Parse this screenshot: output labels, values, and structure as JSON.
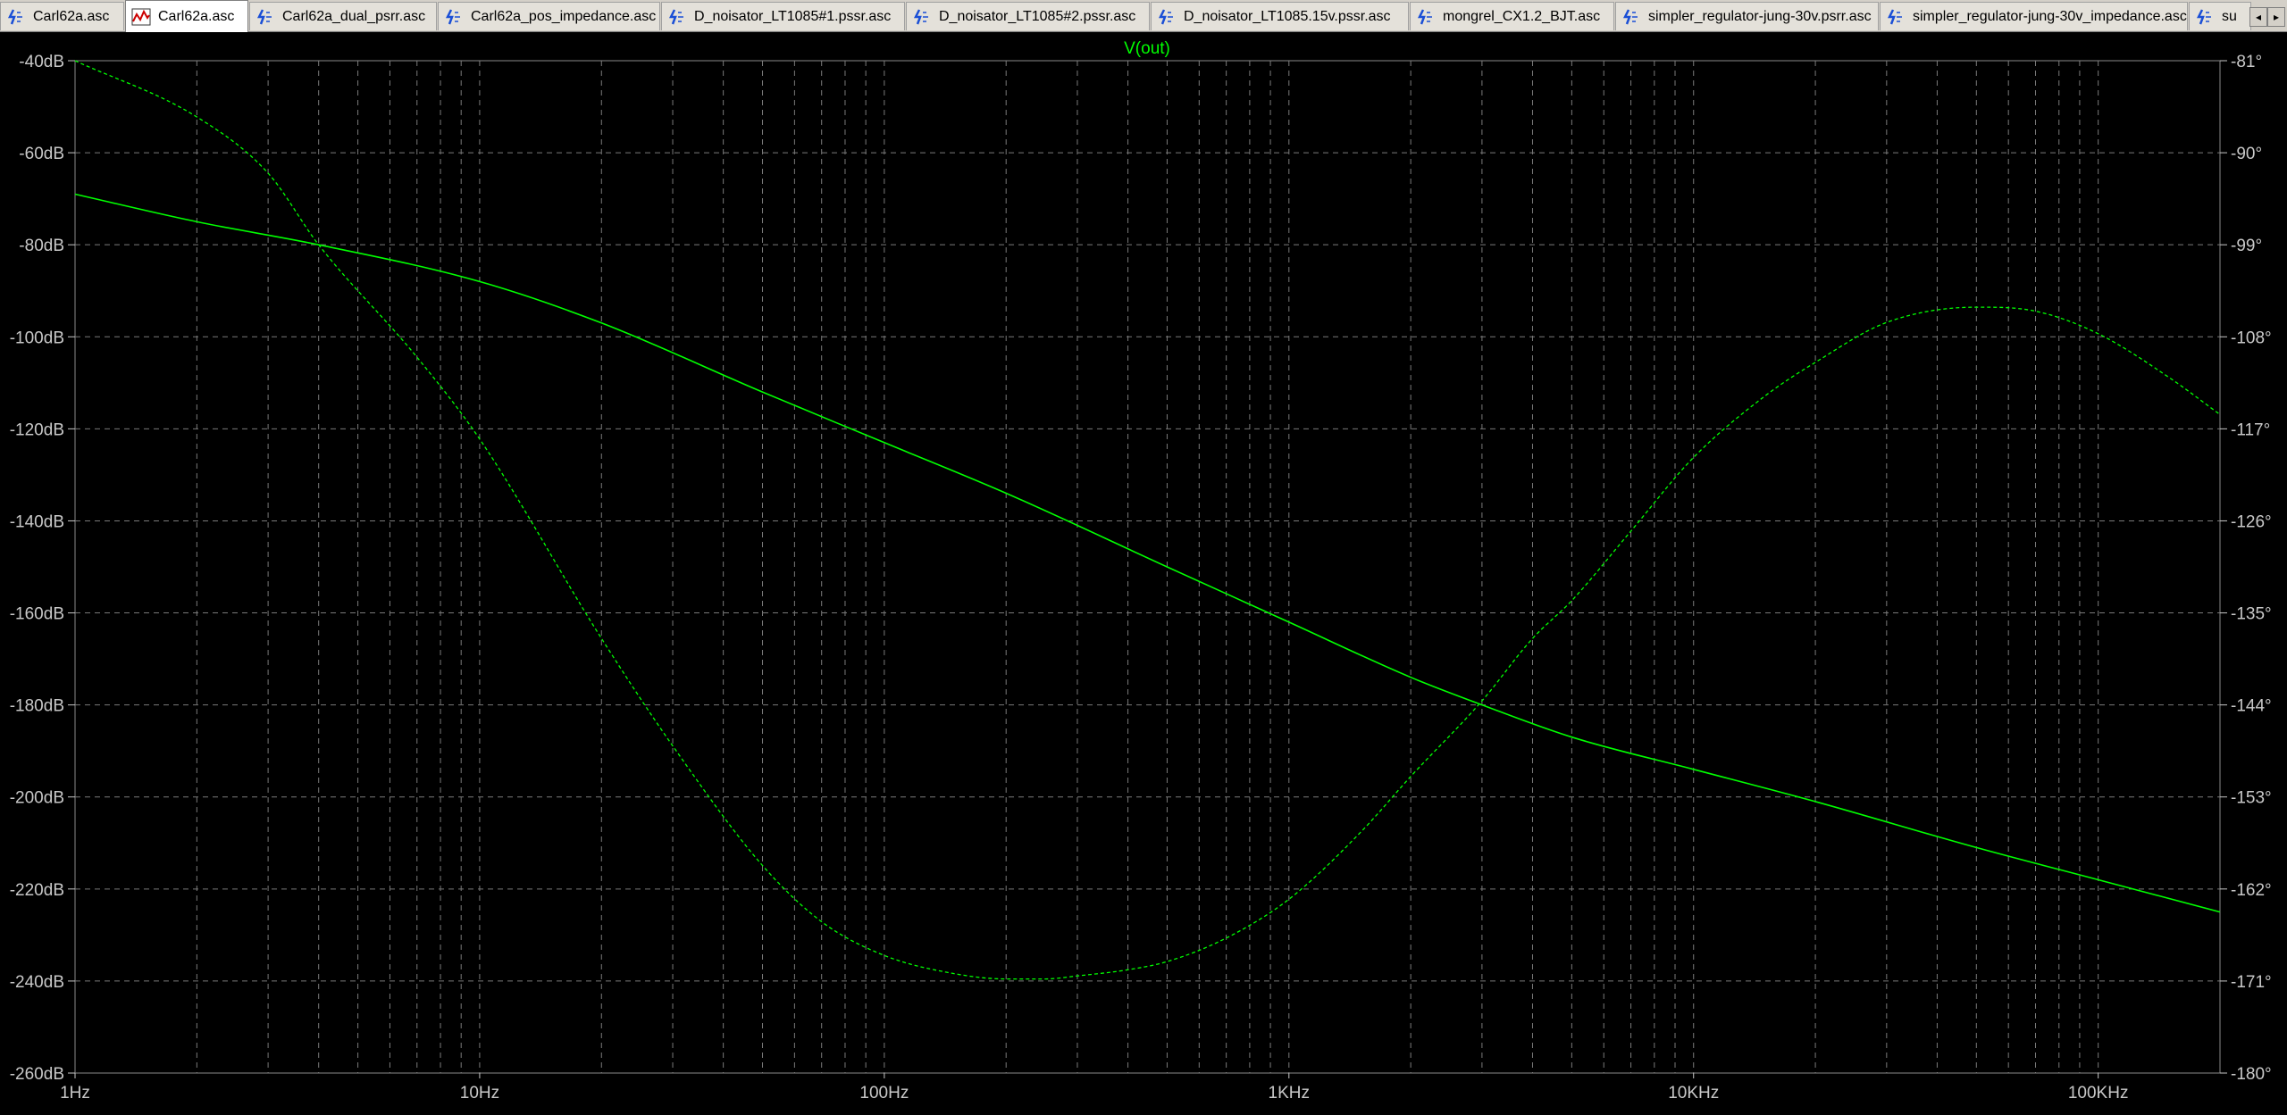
{
  "tabs": [
    {
      "label": "Carl62a.asc",
      "icon": "schematic-icon",
      "active": false
    },
    {
      "label": "Carl62a.asc",
      "icon": "waveform-icon",
      "active": true
    },
    {
      "label": "Carl62a_dual_psrr.asc",
      "icon": "schematic-icon",
      "active": false
    },
    {
      "label": "Carl62a_pos_impedance.asc",
      "icon": "schematic-icon",
      "active": false
    },
    {
      "label": "D_noisator_LT1085#1.pssr.asc",
      "icon": "schematic-icon",
      "active": false
    },
    {
      "label": "D_noisator_LT1085#2.pssr.asc",
      "icon": "schematic-icon",
      "active": false
    },
    {
      "label": "D_noisator_LT1085.15v.pssr.asc",
      "icon": "schematic-icon",
      "active": false
    },
    {
      "label": "mongrel_CX1.2_BJT.asc",
      "icon": "schematic-icon",
      "active": false
    },
    {
      "label": "simpler_regulator-jung-30v.psrr.asc",
      "icon": "schematic-icon",
      "active": false
    },
    {
      "label": "simpler_regulator-jung-30v_impedance.asc",
      "icon": "schematic-icon",
      "active": false
    },
    {
      "label": "su",
      "icon": "schematic-icon",
      "active": false
    }
  ],
  "tab_scroll": {
    "left": "◂",
    "right": "▸"
  },
  "colors": {
    "trace": "#00ff00",
    "grid": "#7a7a7a",
    "axis_text": "#c8c8c8",
    "background": "#000000"
  },
  "chart_data": {
    "type": "line",
    "title": "V(out)",
    "x_scale": "log",
    "x_range_hz": [
      1,
      200000
    ],
    "x_tick_labels": [
      "1Hz",
      "10Hz",
      "100Hz",
      "1KHz",
      "10KHz",
      "100KHz"
    ],
    "x_tick_values": [
      1,
      10,
      100,
      1000,
      10000,
      100000
    ],
    "y_left_range_db": [
      -260,
      -40
    ],
    "y_left_ticks": [
      "-40dB",
      "-60dB",
      "-80dB",
      "-100dB",
      "-120dB",
      "-140dB",
      "-160dB",
      "-180dB",
      "-200dB",
      "-220dB",
      "-240dB",
      "-260dB"
    ],
    "y_right_range_deg": [
      -180,
      -81
    ],
    "y_right_ticks": [
      "-81°",
      "-90°",
      "-99°",
      "-108°",
      "-117°",
      "-126°",
      "-135°",
      "-144°",
      "-153°",
      "-162°",
      "-171°",
      "-180°"
    ],
    "grid": true,
    "series": [
      {
        "name": "magnitude",
        "style": "solid",
        "axis": "left",
        "x": [
          1,
          2,
          4,
          10,
          20,
          50,
          100,
          200,
          500,
          1000,
          2000,
          3000,
          5000,
          10000,
          20000,
          50000,
          100000,
          200000
        ],
        "y": [
          -69,
          -75,
          -80,
          -88,
          -97,
          -112,
          -123,
          -134,
          -150,
          -162,
          -174,
          -180,
          -187,
          -194,
          -201,
          -211,
          -218,
          -225
        ]
      },
      {
        "name": "phase",
        "style": "dashed",
        "axis": "right",
        "x": [
          1,
          2,
          3,
          4,
          7,
          10,
          20,
          30,
          50,
          70,
          100,
          150,
          200,
          250,
          300,
          400,
          500,
          700,
          1000,
          1500,
          2000,
          3000,
          4000,
          5000,
          7000,
          10000,
          15000,
          20000,
          30000,
          50000,
          70000,
          100000,
          150000,
          200000
        ],
        "y": [
          -81,
          -86.5,
          -92,
          -99,
          -110,
          -118,
          -137.5,
          -148,
          -159.7,
          -165.2,
          -168.5,
          -170.3,
          -170.8,
          -170.8,
          -170.5,
          -169.9,
          -169.1,
          -166.8,
          -163,
          -156.5,
          -151,
          -143.6,
          -137.5,
          -133.8,
          -127,
          -119.8,
          -113.8,
          -110.5,
          -106.6,
          -105.1,
          -105.5,
          -107.7,
          -112,
          -115.6
        ]
      }
    ]
  }
}
